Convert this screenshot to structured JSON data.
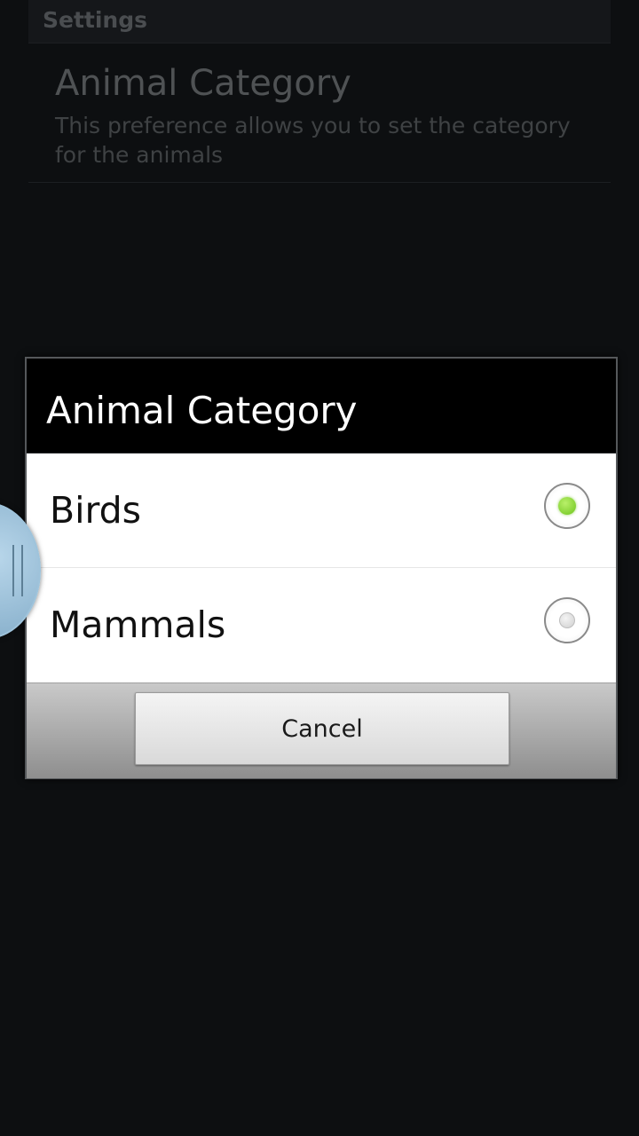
{
  "settings": {
    "header_label": "Settings",
    "preference": {
      "title": "Animal Category",
      "summary": "This preference allows you to set the category for the animals"
    }
  },
  "dialog": {
    "title": "Animal Category",
    "options": [
      {
        "label": "Birds",
        "selected": true
      },
      {
        "label": "Mammals",
        "selected": false
      }
    ],
    "cancel_label": "Cancel"
  },
  "colors": {
    "radio_selected": "#6dc41c",
    "background": "#0d0f11",
    "dialog_body": "#ffffff"
  },
  "icons": {
    "side_handle": "drag-handle-icon",
    "radio_selected": "radio-checked-icon",
    "radio_unselected": "radio-unchecked-icon"
  }
}
